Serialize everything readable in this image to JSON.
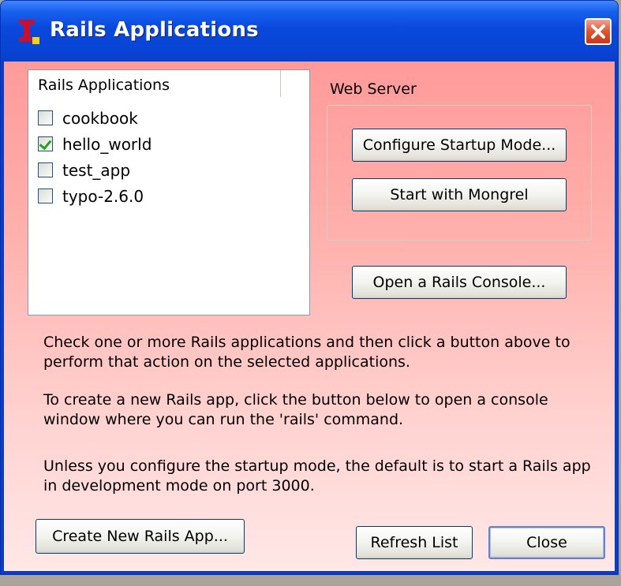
{
  "window": {
    "title": "Rails Applications",
    "close_icon": "close-x-icon",
    "app_icon": "rails-i-icon"
  },
  "list": {
    "header": "Rails Applications",
    "items": [
      {
        "label": "cookbook",
        "checked": false
      },
      {
        "label": "hello_world",
        "checked": true
      },
      {
        "label": "test_app",
        "checked": false
      },
      {
        "label": "typo-2.6.0",
        "checked": false
      }
    ]
  },
  "web_server": {
    "label": "Web Server",
    "configure_label": "Configure Startup Mode...",
    "start_label": "Start with Mongrel"
  },
  "console_label": "Open a Rails Console...",
  "info": {
    "p1_line1": "Check one or more Rails applications and then click a button above to",
    "p1_line2": "perform that action on the selected applications.",
    "p2_line1": "To create a new Rails app, click the button below to open a console",
    "p2_line2": "window where you can run the 'rails' command.",
    "p3_line1": "Unless you configure the startup mode, the default is to start a Rails app",
    "p3_line2": "in development mode on port 3000."
  },
  "buttons": {
    "create_label": "Create New Rails App...",
    "refresh_label": "Refresh List",
    "close_label": "Close"
  },
  "colors": {
    "titlebar": "#0a48dc",
    "client_top": "#ff9a9a",
    "client_bottom": "#ffe8e7",
    "close_button": "#e0542e",
    "check": "#21a121"
  }
}
